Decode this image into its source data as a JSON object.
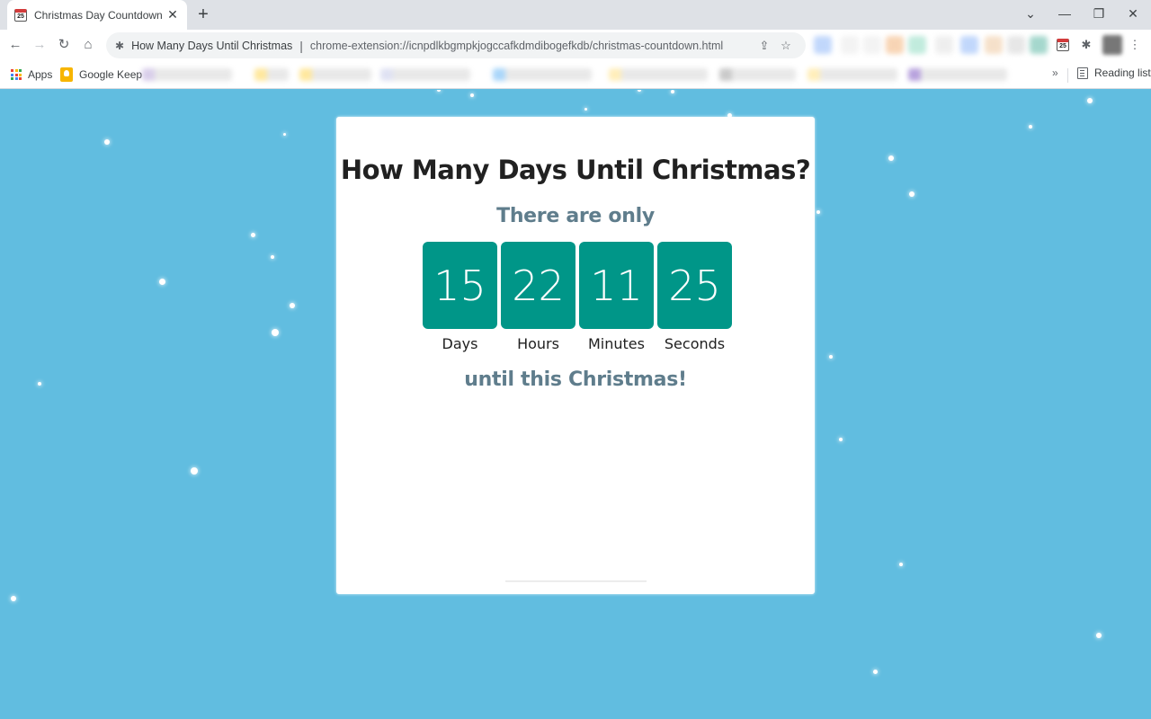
{
  "browser": {
    "tab": {
      "title": "Christmas Day Countdown",
      "favicon": "calendar-25-icon",
      "favicon_text": "25"
    },
    "new_tab_label": "+",
    "window_controls": {
      "tab_search": "⌄",
      "minimize": "—",
      "restore": "❐",
      "close": "✕"
    },
    "nav": {
      "back": "←",
      "forward": "→",
      "reload": "↻",
      "home": "⌂"
    },
    "omnibox": {
      "page_title": "How Many Days Until Christmas",
      "separator": "|",
      "url": "chrome-extension://icnpdlkbgmpkjogccafkdmdibogefkdb/christmas-countdown.html",
      "share_icon": "⇪",
      "star_icon": "☆"
    },
    "toolbar_icons": {
      "extensions": "✱",
      "menu": "⋮",
      "pinned_extension_text": "25"
    },
    "bookmarks": {
      "apps_label": "Apps",
      "apps_colors": [
        "#ea4335",
        "#fbbc04",
        "#34a853",
        "#4285f4",
        "#ea4335",
        "#fbbc04",
        "#34a853",
        "#4285f4",
        "#ea4335"
      ],
      "keep_label": "Google Keep",
      "blurred_colors": [
        "#b9a6d9",
        "#ffd54f",
        "#ffd54f",
        "#c5cae9",
        "#64b5f6",
        "#ffe082",
        "#9e9e9e",
        "#ffe082",
        "#7e57c2"
      ],
      "overflow": "»",
      "reading_list_label": "Reading list"
    },
    "extension_blur_colors": [
      "#a8c7fa",
      "#eeeeee",
      "#eeeeee",
      "#f5c396",
      "#a7e3cf",
      "#e8e8e8",
      "#a8c7fa",
      "#f2d4b4",
      "#dddddd",
      "#7fc7b8"
    ]
  },
  "countdown": {
    "title": "How Many Days Until Christmas?",
    "lead": "There are only",
    "units": [
      {
        "value": "15",
        "label": "Days"
      },
      {
        "value": "22",
        "label": "Hours"
      },
      {
        "value": "11",
        "label": "Minutes"
      },
      {
        "value": "25",
        "label": "Seconds"
      }
    ],
    "trail": "until this Christmas!"
  },
  "colors": {
    "background": "#61bde0",
    "tile": "#009688",
    "subtext": "#5f7d8c",
    "title": "#212121"
  }
}
